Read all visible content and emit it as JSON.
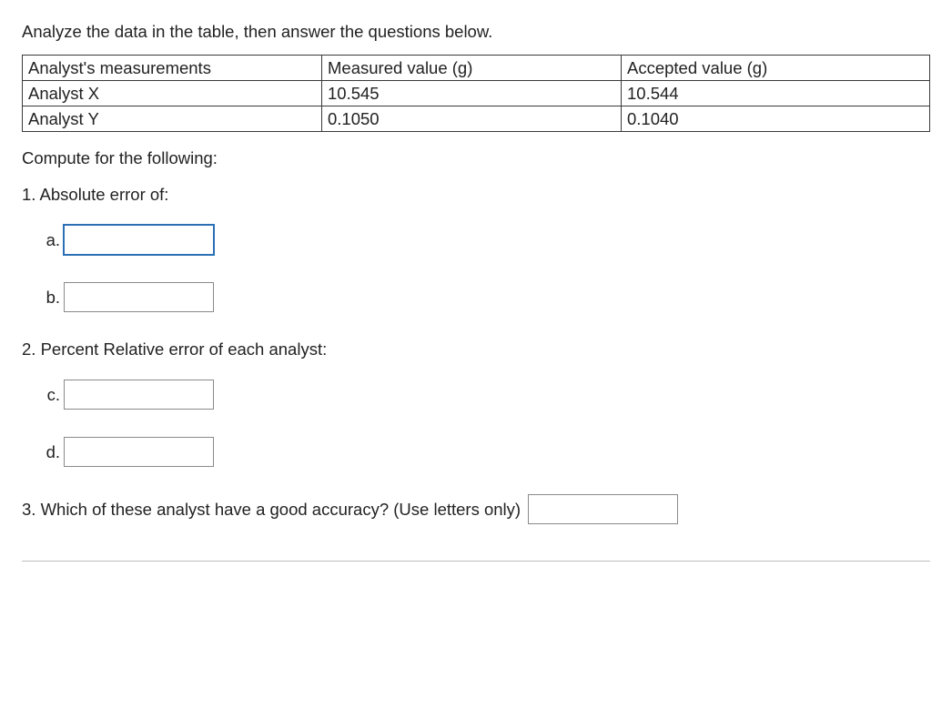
{
  "intro": "Analyze the data in the table, then answer the questions below.",
  "table": {
    "headers": {
      "col1": "Analyst's measurements",
      "col2": "Measured value (g)",
      "col3": "Accepted value (g)"
    },
    "rows": [
      {
        "c1": "Analyst X",
        "c2": "10.545",
        "c3": "10.544"
      },
      {
        "c1": "Analyst Y",
        "c2": "0.1050",
        "c3": "0.1040"
      }
    ]
  },
  "compute_prompt": "Compute for the following:",
  "q1": {
    "heading": "1. Absolute error of:",
    "a_label": "a.",
    "b_label": "b."
  },
  "q2": {
    "heading": "2.  Percent Relative error of each analyst:",
    "c_label": "c.",
    "d_label": "d."
  },
  "q3": {
    "text": "3. Which of these analyst have a good accuracy? (Use letters only)"
  },
  "inputs": {
    "a_value": "",
    "b_value": "",
    "c_value": "",
    "d_value": "",
    "q3_value": ""
  }
}
